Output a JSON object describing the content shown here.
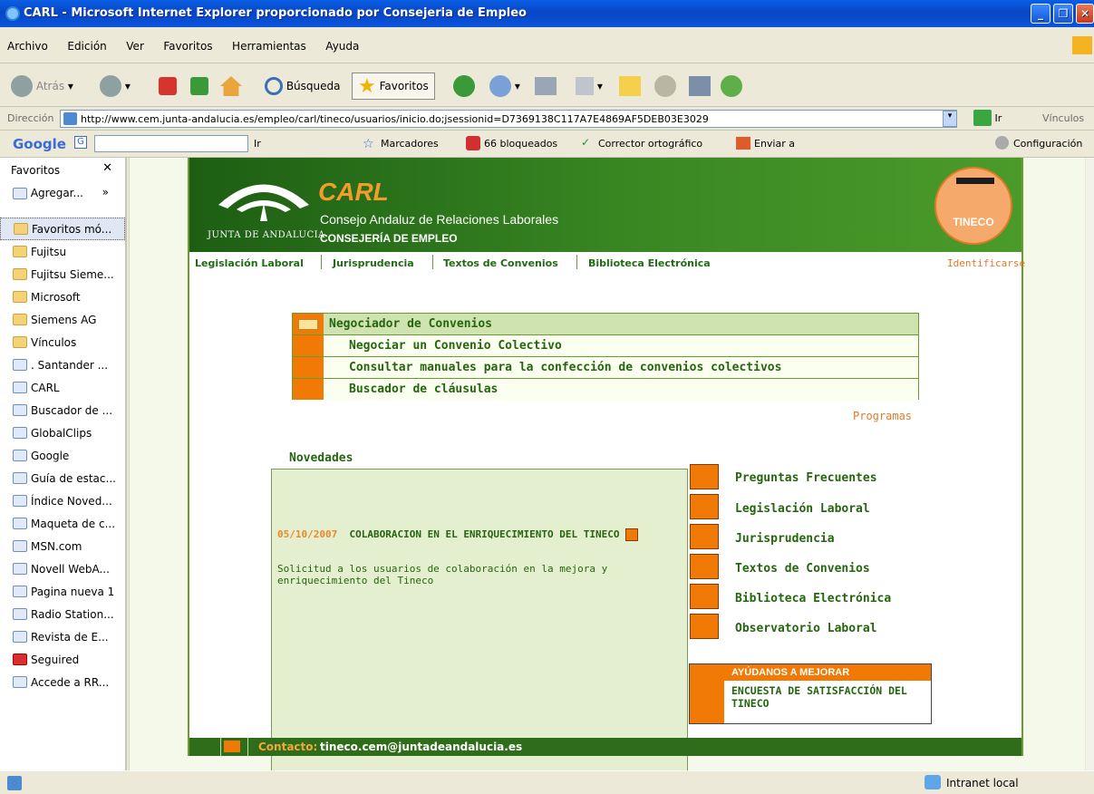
{
  "window": {
    "title": "CARL - Microsoft Internet Explorer proporcionado por Consejeria de Empleo"
  },
  "menu": [
    "Archivo",
    "Edición",
    "Ver",
    "Favoritos",
    "Herramientas",
    "Ayuda"
  ],
  "toolbar": {
    "back": "Atrás",
    "search": "Búsqueda",
    "favorites": "Favoritos"
  },
  "address": {
    "label": "Dirección",
    "url": "http://www.cem.junta-andalucia.es/empleo/carl/tineco/usuarios/inicio.do;jsessionid=D7369138C117A7E4869AF5DEB03E3029",
    "go": "Ir",
    "links": "Vínculos"
  },
  "google_bar": {
    "logo": "Google",
    "go": "Ir",
    "bookmarks": "Marcadores",
    "blocked": "66 bloqueados",
    "spell": "Corrector ortográfico",
    "send": "Enviar a",
    "settings": "Configuración"
  },
  "sidebar": {
    "title": "Favoritos",
    "add": "Agregar...",
    "items": [
      {
        "label": "Favoritos mó...",
        "type": "folder"
      },
      {
        "label": "Fujitsu",
        "type": "folder"
      },
      {
        "label": "Fujitsu Sieme...",
        "type": "folder"
      },
      {
        "label": "Microsoft",
        "type": "folder"
      },
      {
        "label": "Siemens AG",
        "type": "folder"
      },
      {
        "label": "Vínculos",
        "type": "folder"
      },
      {
        "label": ". Santander ...",
        "type": "page"
      },
      {
        "label": "CARL",
        "type": "page"
      },
      {
        "label": "Buscador de ...",
        "type": "page"
      },
      {
        "label": "GlobalClips",
        "type": "page"
      },
      {
        "label": "Google",
        "type": "page"
      },
      {
        "label": "Guía de estac...",
        "type": "page"
      },
      {
        "label": "Índice Noved...",
        "type": "page"
      },
      {
        "label": "Maqueta de c...",
        "type": "page"
      },
      {
        "label": "MSN.com",
        "type": "page"
      },
      {
        "label": "Novell WebA...",
        "type": "page"
      },
      {
        "label": "Pagina nueva 1",
        "type": "page"
      },
      {
        "label": "Radio Station...",
        "type": "page"
      },
      {
        "label": "Revista de E...",
        "type": "page"
      },
      {
        "label": "Seguired",
        "type": "page"
      },
      {
        "label": "Accede a RR...",
        "type": "page"
      }
    ]
  },
  "site": {
    "logo_text": "JUNTA DE ANDALUCIA",
    "brand": "CARL",
    "brand_full": "Consejo Andaluz de Relaciones Laborales",
    "department": "CONSEJERÍA DE EMPLEO",
    "tineco": "TINECO",
    "nav": [
      "Legislación Laboral",
      "Jurisprudencia",
      "Textos de Convenios",
      "Biblioteca Electrónica"
    ],
    "login": "Identificarse",
    "menu_header": "Negociador de Convenios",
    "menu_items": [
      "Negociar un Convenio Colectivo",
      "Consultar manuales para la confección de convenios colectivos",
      "Buscador de cláusulas"
    ],
    "programs": "Programas",
    "news_title": "Novedades",
    "news": {
      "date": "05/10/2007",
      "headline": "COLABORACION EN EL ENRIQUECIMIENTO DEL TINECO",
      "body": "Solicitud a los usuarios de colaboración en la mejora y enriquecimiento del Tineco"
    },
    "links": [
      "Preguntas Frecuentes",
      "Legislación Laboral",
      "Jurisprudencia",
      "Textos de Convenios",
      "Biblioteca Electrónica",
      "Observatorio Laboral"
    ],
    "survey_title": "AYÚDANOS A MEJORAR",
    "survey_text": "ENCUESTA DE SATISFACCIÓN DEL TINECO",
    "contact_label": "Contacto:",
    "contact_email": "tineco.cem@juntadeandalucia.es"
  },
  "status": {
    "zone": "Intranet local"
  },
  "colors": {
    "accent_green": "#2f7d1c",
    "accent_orange": "#f07a05",
    "xp_blue": "#0846c4"
  }
}
